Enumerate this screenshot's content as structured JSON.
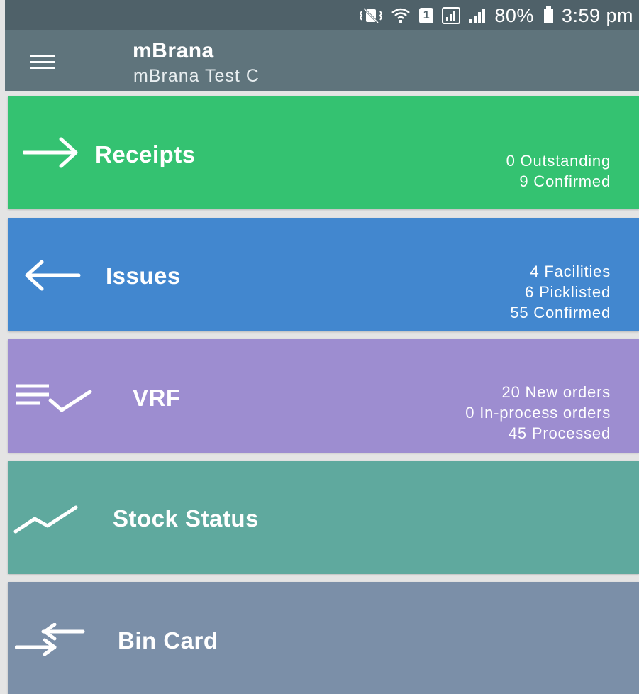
{
  "status_bar": {
    "signal_icon": "signal-bars-icon",
    "battery_percent": "80%",
    "time": "3:59 pm",
    "sim_slot": "1"
  },
  "app_bar": {
    "title": "mBrana",
    "subtitle": "mBrana Test C"
  },
  "tiles": [
    {
      "label": "Receipts",
      "icon": "arrow-right-icon",
      "color": "#34c271",
      "stats": [
        "0 Outstanding",
        "9 Confirmed"
      ]
    },
    {
      "label": "Issues",
      "icon": "arrow-left-icon",
      "color": "#4287cf",
      "stats": [
        "4 Facilities",
        "6 Picklisted",
        "55 Confirmed"
      ]
    },
    {
      "label": "VRF",
      "icon": "playlist-check-icon",
      "color": "#9d8dd0",
      "stats": [
        "20 New orders",
        "0 In-process orders",
        "45 Processed"
      ]
    },
    {
      "label": "Stock Status",
      "icon": "trend-line-icon",
      "color": "#5fa99e",
      "stats": []
    },
    {
      "label": "Bin Card",
      "icon": "swap-arrows-icon",
      "color": "#7b8fa8",
      "stats": []
    }
  ]
}
